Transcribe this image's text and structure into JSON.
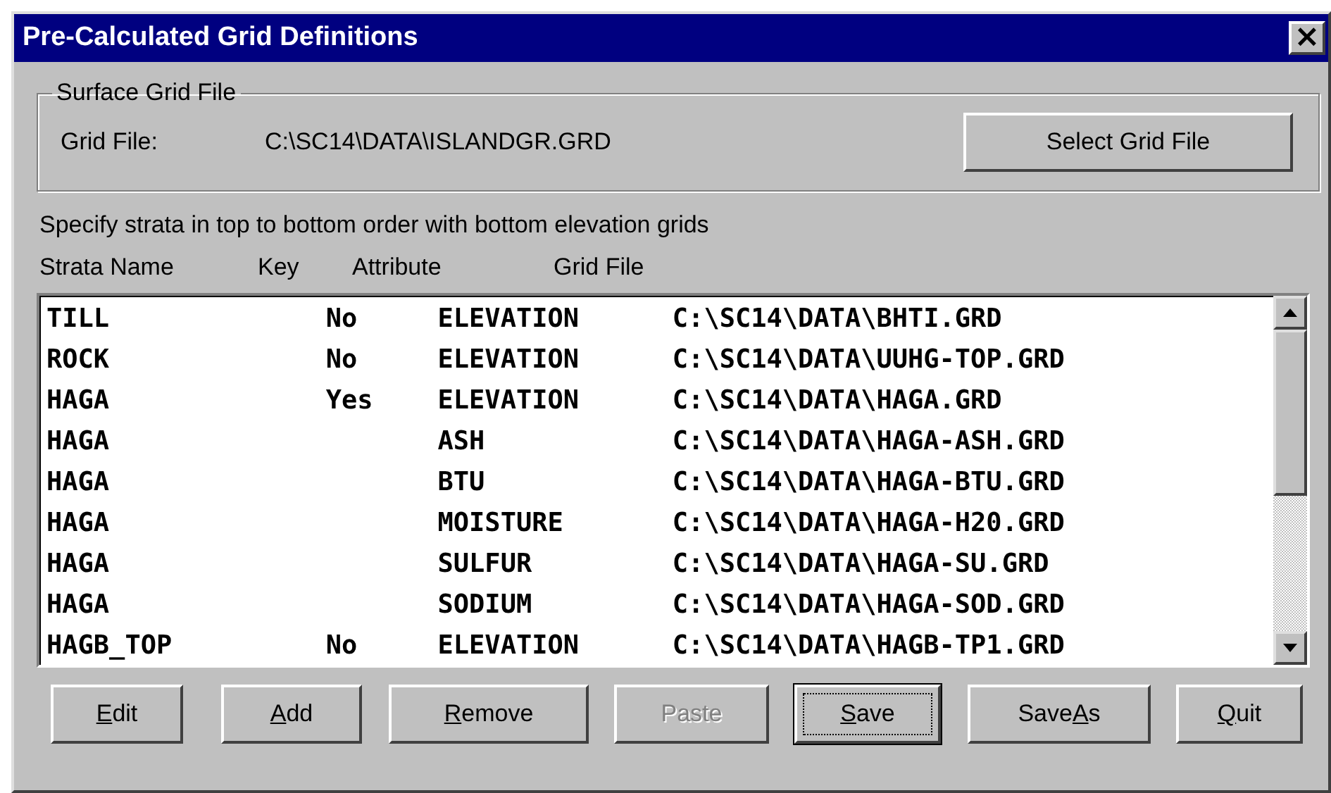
{
  "window": {
    "title": "Pre-Calculated Grid Definitions",
    "close": "×"
  },
  "surface_group": {
    "title": "Surface Grid File",
    "label": "Grid File:",
    "value": "C:\\SC14\\DATA\\ISLANDGR.GRD",
    "button": "Select Grid File"
  },
  "instruction": "Specify strata in top to bottom order with bottom elevation grids",
  "table": {
    "columns": [
      "Strata Name",
      "Key",
      "Attribute",
      "Grid File"
    ],
    "rows": [
      {
        "cells": [
          "TILL",
          "No",
          "ELEVATION",
          "C:\\SC14\\DATA\\BHTI.GRD"
        ]
      },
      {
        "cells": [
          "ROCK",
          "No",
          "ELEVATION",
          "C:\\SC14\\DATA\\UUHG-TOP.GRD"
        ]
      },
      {
        "cells": [
          "HAGA",
          "Yes",
          "ELEVATION",
          "C:\\SC14\\DATA\\HAGA.GRD"
        ]
      },
      {
        "cells": [
          "HAGA",
          null,
          "ASH",
          "C:\\SC14\\DATA\\HAGA-ASH.GRD"
        ]
      },
      {
        "cells": [
          "HAGA",
          null,
          "BTU",
          "C:\\SC14\\DATA\\HAGA-BTU.GRD"
        ]
      },
      {
        "cells": [
          "HAGA",
          null,
          "MOISTURE",
          "C:\\SC14\\DATA\\HAGA-H20.GRD"
        ]
      },
      {
        "cells": [
          "HAGA",
          null,
          "SULFUR",
          "C:\\SC14\\DATA\\HAGA-SU.GRD"
        ]
      },
      {
        "cells": [
          "HAGA",
          null,
          "SODIUM",
          "C:\\SC14\\DATA\\HAGA-SOD.GRD"
        ]
      },
      {
        "cells": [
          "HAGB_TOP",
          "No",
          "ELEVATION",
          "C:\\SC14\\DATA\\HAGB-TP1.GRD"
        ]
      }
    ]
  },
  "buttons": [
    {
      "key": "E",
      "after": "dit",
      "disabled": false,
      "focused": false
    },
    {
      "key": "A",
      "after": "dd",
      "disabled": false,
      "focused": false
    },
    {
      "key": "R",
      "after": "emove",
      "disabled": false,
      "focused": false
    },
    {
      "before": "Paste",
      "disabled": true,
      "focused": false
    },
    {
      "key": "S",
      "after": "ave",
      "disabled": false,
      "focused": true
    },
    {
      "before": "Save",
      "key": "A",
      "after": "s",
      "disabled": false,
      "focused": false
    },
    {
      "key": "Q",
      "after": "uit",
      "disabled": false,
      "focused": false
    }
  ]
}
